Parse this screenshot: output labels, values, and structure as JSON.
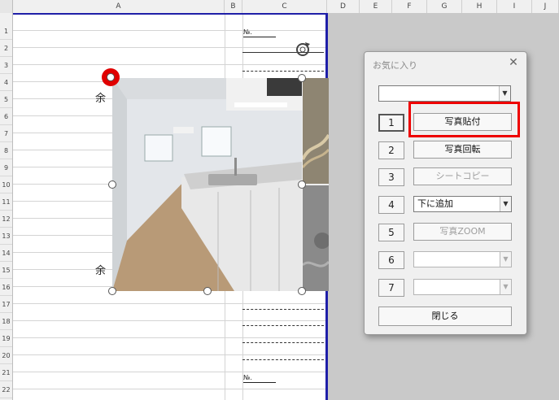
{
  "columns": [
    {
      "label": "",
      "w": 16
    },
    {
      "label": "A",
      "w": 260
    },
    {
      "label": "B",
      "w": 22
    },
    {
      "label": "C",
      "w": 104
    },
    {
      "label": "D",
      "w": 40
    },
    {
      "label": "E",
      "w": 40
    },
    {
      "label": "F",
      "w": 43
    },
    {
      "label": "G",
      "w": 43
    },
    {
      "label": "H",
      "w": 43
    },
    {
      "label": "I",
      "w": 43
    },
    {
      "label": "J",
      "w": 33
    }
  ],
  "rows": [
    "1",
    "2",
    "3",
    "4",
    "5",
    "6",
    "7",
    "8",
    "9",
    "10",
    "11",
    "12",
    "13",
    "14",
    "15",
    "16",
    "17",
    "18",
    "19",
    "20",
    "21",
    "22"
  ],
  "sheet": {
    "no_label": "№.",
    "yo_label": "余"
  },
  "dialog": {
    "title": "お気に入り",
    "close_glyph": "✕",
    "top_combo_value": "",
    "arrow_glyph": "▼",
    "rows": [
      {
        "num": "1",
        "action": "写真貼付",
        "kind": "button",
        "enabled": true
      },
      {
        "num": "2",
        "action": "写真回転",
        "kind": "button",
        "enabled": true
      },
      {
        "num": "3",
        "action": "シートコピー",
        "kind": "button",
        "enabled": false
      },
      {
        "num": "4",
        "action": "下に追加",
        "kind": "combo",
        "enabled": true
      },
      {
        "num": "5",
        "action": "写真ZOOM",
        "kind": "button",
        "enabled": false
      },
      {
        "num": "6",
        "action": "",
        "kind": "combo",
        "enabled": false
      },
      {
        "num": "7",
        "action": "",
        "kind": "combo",
        "enabled": false
      }
    ],
    "close_button": "閉じる"
  },
  "colors": {
    "highlight": "#ee0000",
    "print_border": "#1f1fa8"
  }
}
